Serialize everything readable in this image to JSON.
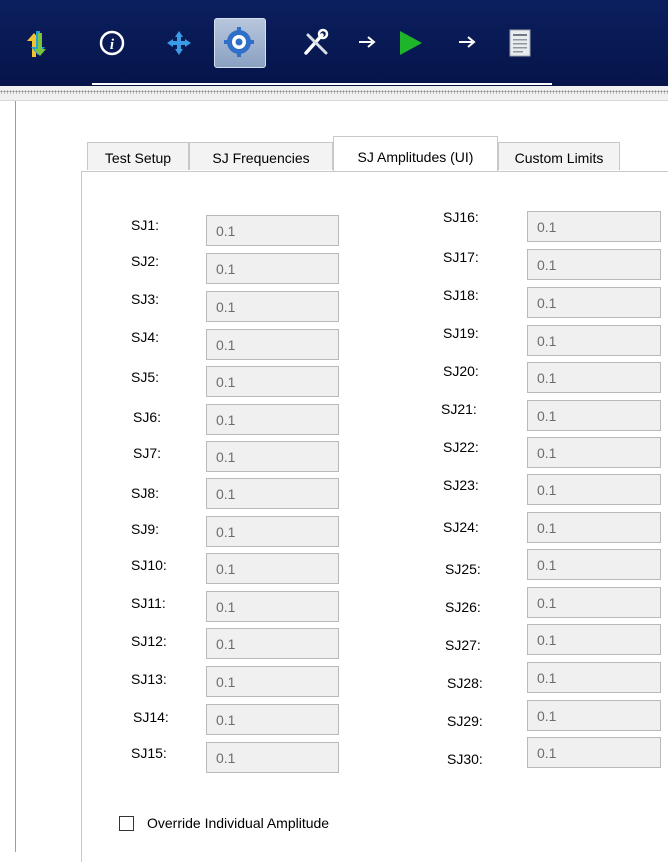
{
  "toolbar": {
    "icons": [
      "transfer-arrows-icon",
      "info-icon",
      "move-crosshair-icon",
      "settings-gear-icon",
      "tools-icon",
      "arrow-right-icon",
      "play-icon",
      "arrow-right-icon",
      "report-icon"
    ],
    "colors": {
      "background": "#0b1f5e",
      "play": "#1fb52b",
      "selected": "#9fb3d0"
    }
  },
  "tabs": [
    {
      "label": "Test Setup",
      "active": false
    },
    {
      "label": "SJ Frequencies",
      "active": false
    },
    {
      "label": "SJ Amplitudes (UI)",
      "active": true
    },
    {
      "label": "Custom Limits",
      "active": false
    }
  ],
  "left_fields": [
    {
      "label": "SJ1:",
      "value": "0.1"
    },
    {
      "label": "SJ2:",
      "value": "0.1"
    },
    {
      "label": "SJ3:",
      "value": "0.1"
    },
    {
      "label": "SJ4:",
      "value": "0.1"
    },
    {
      "label": "SJ5:",
      "value": "0.1"
    },
    {
      "label": "SJ6:",
      "value": "0.1"
    },
    {
      "label": "SJ7:",
      "value": "0.1"
    },
    {
      "label": "SJ8:",
      "value": "0.1"
    },
    {
      "label": "SJ9:",
      "value": "0.1"
    },
    {
      "label": "SJ10:",
      "value": "0.1"
    },
    {
      "label": "SJ11:",
      "value": "0.1"
    },
    {
      "label": "SJ12:",
      "value": "0.1"
    },
    {
      "label": "SJ13:",
      "value": "0.1"
    },
    {
      "label": "SJ14:",
      "value": "0.1"
    },
    {
      "label": "SJ15:",
      "value": "0.1"
    }
  ],
  "right_fields": [
    {
      "label": "SJ16:",
      "value": "0.1"
    },
    {
      "label": "SJ17:",
      "value": "0.1"
    },
    {
      "label": "SJ18:",
      "value": "0.1"
    },
    {
      "label": "SJ19:",
      "value": "0.1"
    },
    {
      "label": "SJ20:",
      "value": "0.1"
    },
    {
      "label": "SJ21:",
      "value": "0.1"
    },
    {
      "label": "SJ22:",
      "value": "0.1"
    },
    {
      "label": "SJ23:",
      "value": "0.1"
    },
    {
      "label": "SJ24:",
      "value": "0.1"
    },
    {
      "label": "SJ25:",
      "value": "0.1"
    },
    {
      "label": "SJ26:",
      "value": "0.1"
    },
    {
      "label": "SJ27:",
      "value": "0.1"
    },
    {
      "label": "SJ28:",
      "value": "0.1"
    },
    {
      "label": "SJ29:",
      "value": "0.1"
    },
    {
      "label": "SJ30:",
      "value": "0.1"
    }
  ],
  "override": {
    "label": "Override Individual Amplitude",
    "checked": false
  }
}
